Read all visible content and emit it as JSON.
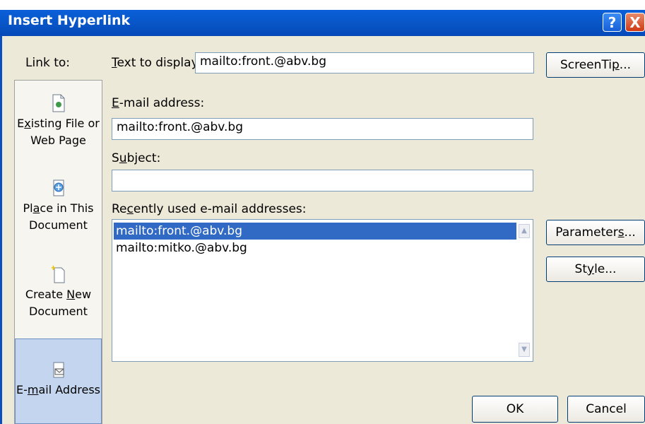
{
  "dialog": {
    "title": "Insert Hyperlink",
    "help_glyph": "?",
    "close_glyph": "X"
  },
  "link_to": {
    "label": "Link to:",
    "places": [
      {
        "line1_pre": "E",
        "line1_u": "x",
        "line1_post": "isting File or",
        "line2": "Web Page",
        "icon": "file-icon"
      },
      {
        "line1_pre": "Pl",
        "line1_u": "a",
        "line1_post": "ce in This",
        "line2": "Document",
        "icon": "place-icon"
      },
      {
        "line1_pre": "Create ",
        "line1_u": "N",
        "line1_post": "ew",
        "line2": "Document",
        "icon": "new-doc-icon"
      },
      {
        "line1_pre": "E-",
        "line1_u": "m",
        "line1_post": "ail Address",
        "line2": "",
        "icon": "email-icon",
        "selected": true
      }
    ]
  },
  "text_to_display": {
    "label_u": "T",
    "label_rest": "ext to display:",
    "value": "mailto:front.@abv.bg"
  },
  "email_address": {
    "label_u": "E",
    "label_rest": "-mail address:",
    "value": "mailto:front.@abv.bg"
  },
  "subject": {
    "label_pre": "S",
    "label_u": "u",
    "label_rest": "bject:",
    "value": ""
  },
  "recent": {
    "label_pre": "Re",
    "label_u": "c",
    "label_rest": "ently used e-mail addresses:",
    "items": [
      "mailto:front.@abv.bg",
      "mailto:mitko.@abv.bg"
    ],
    "selected_index": 0
  },
  "buttons": {
    "screentip_pre": "ScreenTi",
    "screentip_u": "p",
    "screentip_post": "...",
    "parameters_pre": "Parameter",
    "parameters_u": "s",
    "parameters_post": "...",
    "style_pre": "St",
    "style_u": "y",
    "style_post": "le...",
    "ok": "OK",
    "cancel": "Cancel"
  },
  "colors": {
    "titlebar": "#0856c8",
    "selection": "#316ac5",
    "dialog_bg": "#ece9d8"
  }
}
